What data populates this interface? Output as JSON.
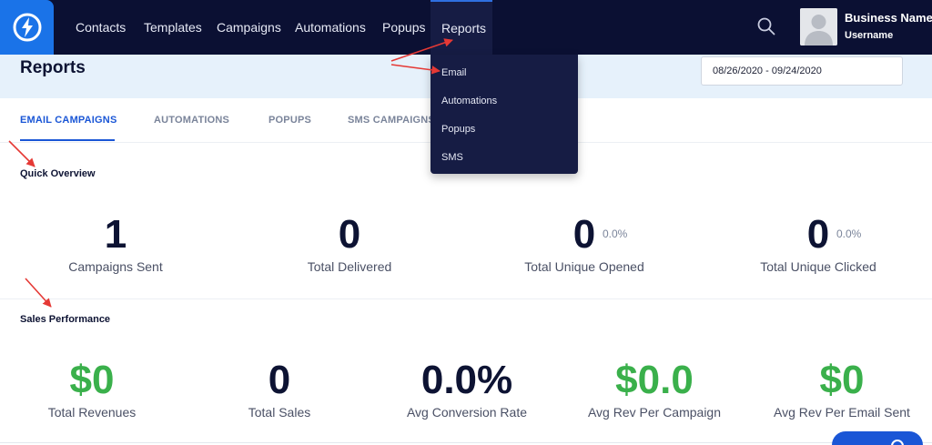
{
  "nav": {
    "items": [
      {
        "label": "Contacts"
      },
      {
        "label": "Templates"
      },
      {
        "label": "Campaigns"
      },
      {
        "label": "Automations"
      },
      {
        "label": "Popups"
      },
      {
        "label": "Reports"
      }
    ],
    "search_icon": "search-icon",
    "logo_icon": "lightning-bolt-icon"
  },
  "user": {
    "name": "Business Name",
    "username": "Username"
  },
  "header": {
    "title": "Reports",
    "date_range": "08/26/2020 - 09/24/2020"
  },
  "tabs": [
    {
      "label": "EMAIL CAMPAIGNS",
      "active": true
    },
    {
      "label": "AUTOMATIONS",
      "active": false
    },
    {
      "label": "POPUPS",
      "active": false
    },
    {
      "label": "SMS CAMPAIGNS",
      "active": false
    }
  ],
  "dropdown": {
    "items": [
      {
        "label": "Email"
      },
      {
        "label": "Automations"
      },
      {
        "label": "Popups"
      },
      {
        "label": "SMS"
      }
    ]
  },
  "quick_overview": {
    "title": "Quick Overview",
    "stats": [
      {
        "value": "1",
        "label": "Campaigns Sent"
      },
      {
        "value": "0",
        "label": "Total Delivered"
      },
      {
        "value": "0",
        "label": "Total Unique Opened",
        "pct": "0.0%"
      },
      {
        "value": "0",
        "label": "Total Unique Clicked",
        "pct": "0.0%"
      }
    ]
  },
  "sales_performance": {
    "title": "Sales Performance",
    "stats": [
      {
        "value": "$0",
        "label": "Total Revenues"
      },
      {
        "value": "0",
        "label": "Total Sales"
      },
      {
        "value": "0.0%",
        "label": "Avg Conversion Rate"
      },
      {
        "value": "$0.0",
        "label": "Avg Rev Per Campaign"
      },
      {
        "value": "$0",
        "label": "Avg Rev Per Email Sent"
      }
    ]
  },
  "colors": {
    "nav_bg": "#0b1033",
    "accent_blue": "#1a73e8",
    "active_tab": "#1a56d6",
    "money_green": "#3ab04b",
    "header_band": "#e6f1fb",
    "annotation_red": "#e53935"
  }
}
